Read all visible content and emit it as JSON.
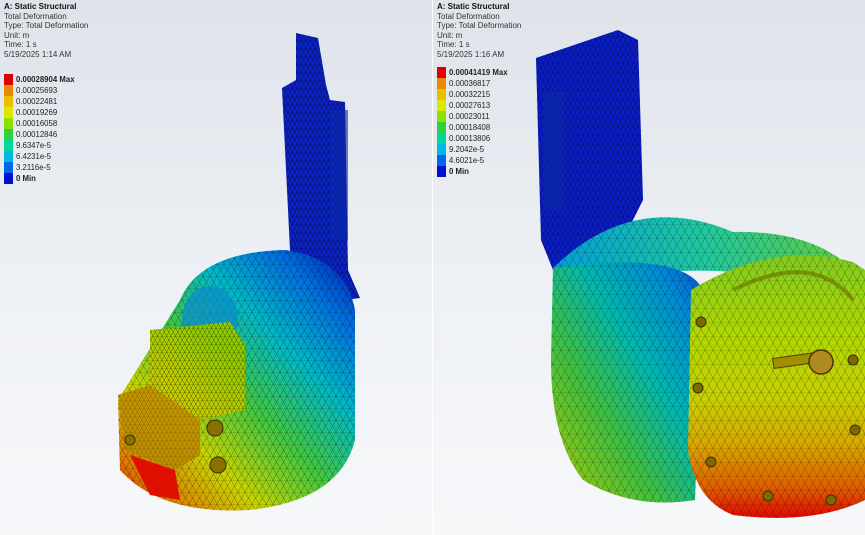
{
  "left": {
    "header": {
      "title": "A: Static Structural",
      "line1": "Total Deformation",
      "line2": "Type: Total Deformation",
      "line3": "Unit: m",
      "line4": "Time: 1 s",
      "line5": "5/19/2025 1:14 AM"
    },
    "legend": [
      {
        "label": "0.00028904 Max",
        "color": "#e00000",
        "bold": true
      },
      {
        "label": "0.00025693",
        "color": "#e88a00"
      },
      {
        "label": "0.00022481",
        "color": "#e8c000"
      },
      {
        "label": "0.00019269",
        "color": "#d8e800"
      },
      {
        "label": "0.00016058",
        "color": "#8ee000"
      },
      {
        "label": "0.00012846",
        "color": "#30d040"
      },
      {
        "label": "9.6347e-5",
        "color": "#00d8a0"
      },
      {
        "label": "6.4231e-5",
        "color": "#00b8e0"
      },
      {
        "label": "3.2116e-5",
        "color": "#0068e8"
      },
      {
        "label": "0 Min",
        "color": "#0010d0",
        "bold": true
      }
    ]
  },
  "right": {
    "header": {
      "title": "A: Static Structural",
      "line1": "Total Deformation",
      "line2": "Type: Total Deformation",
      "line3": "Unit: m",
      "line4": "Time: 1 s",
      "line5": "5/19/2025 1:16 AM"
    },
    "legend": [
      {
        "label": "0.00041419 Max",
        "color": "#e00000",
        "bold": true
      },
      {
        "label": "0.00036817",
        "color": "#e88a00"
      },
      {
        "label": "0.00032215",
        "color": "#e8c000"
      },
      {
        "label": "0.00027613",
        "color": "#d8e800"
      },
      {
        "label": "0.00023011",
        "color": "#8ee000"
      },
      {
        "label": "0.00018408",
        "color": "#30d040"
      },
      {
        "label": "0.00013806",
        "color": "#00d8a0"
      },
      {
        "label": "9.2042e-5",
        "color": "#00b8e0"
      },
      {
        "label": "4.6021e-5",
        "color": "#0068e8"
      },
      {
        "label": "0 Min",
        "color": "#0010d0",
        "bold": true
      }
    ]
  }
}
